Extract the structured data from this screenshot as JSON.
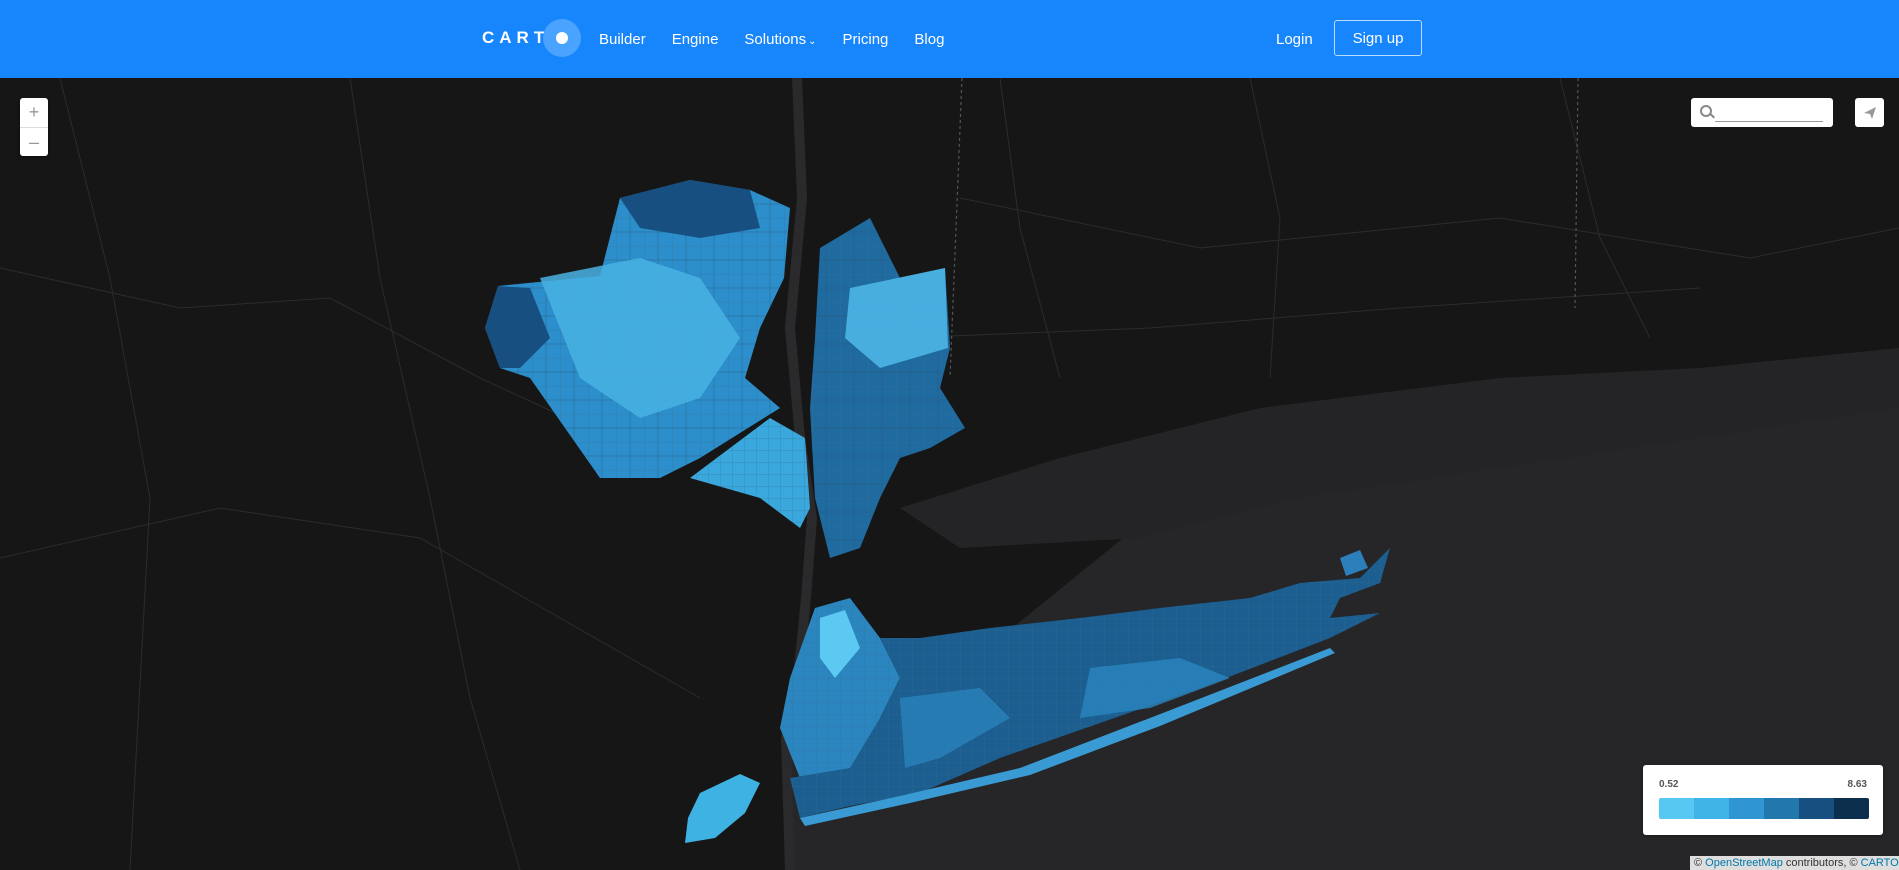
{
  "header": {
    "logo_text": "CART",
    "nav": [
      {
        "label": "Builder"
      },
      {
        "label": "Engine"
      },
      {
        "label": "Solutions"
      },
      {
        "label": "Pricing"
      },
      {
        "label": "Blog"
      }
    ],
    "login_label": "Login",
    "signup_label": "Sign up",
    "bar_color": "#1785fb"
  },
  "map": {
    "zoom_in_label": "+",
    "zoom_out_label": "–",
    "search": {
      "value": "",
      "placeholder": ""
    },
    "share_icon": "paper-plane-icon"
  },
  "legend": {
    "min_label": "0.52",
    "max_label": "8.63",
    "ramp_colors": [
      "#56c8f2",
      "#3eb3e6",
      "#2f96d1",
      "#2277ad",
      "#175080",
      "#0d2f4e"
    ]
  },
  "attribution": {
    "prefix": "© ",
    "osm_link": "OpenStreetMap",
    "middle": " contributors, © ",
    "carto_link": "CARTO"
  }
}
